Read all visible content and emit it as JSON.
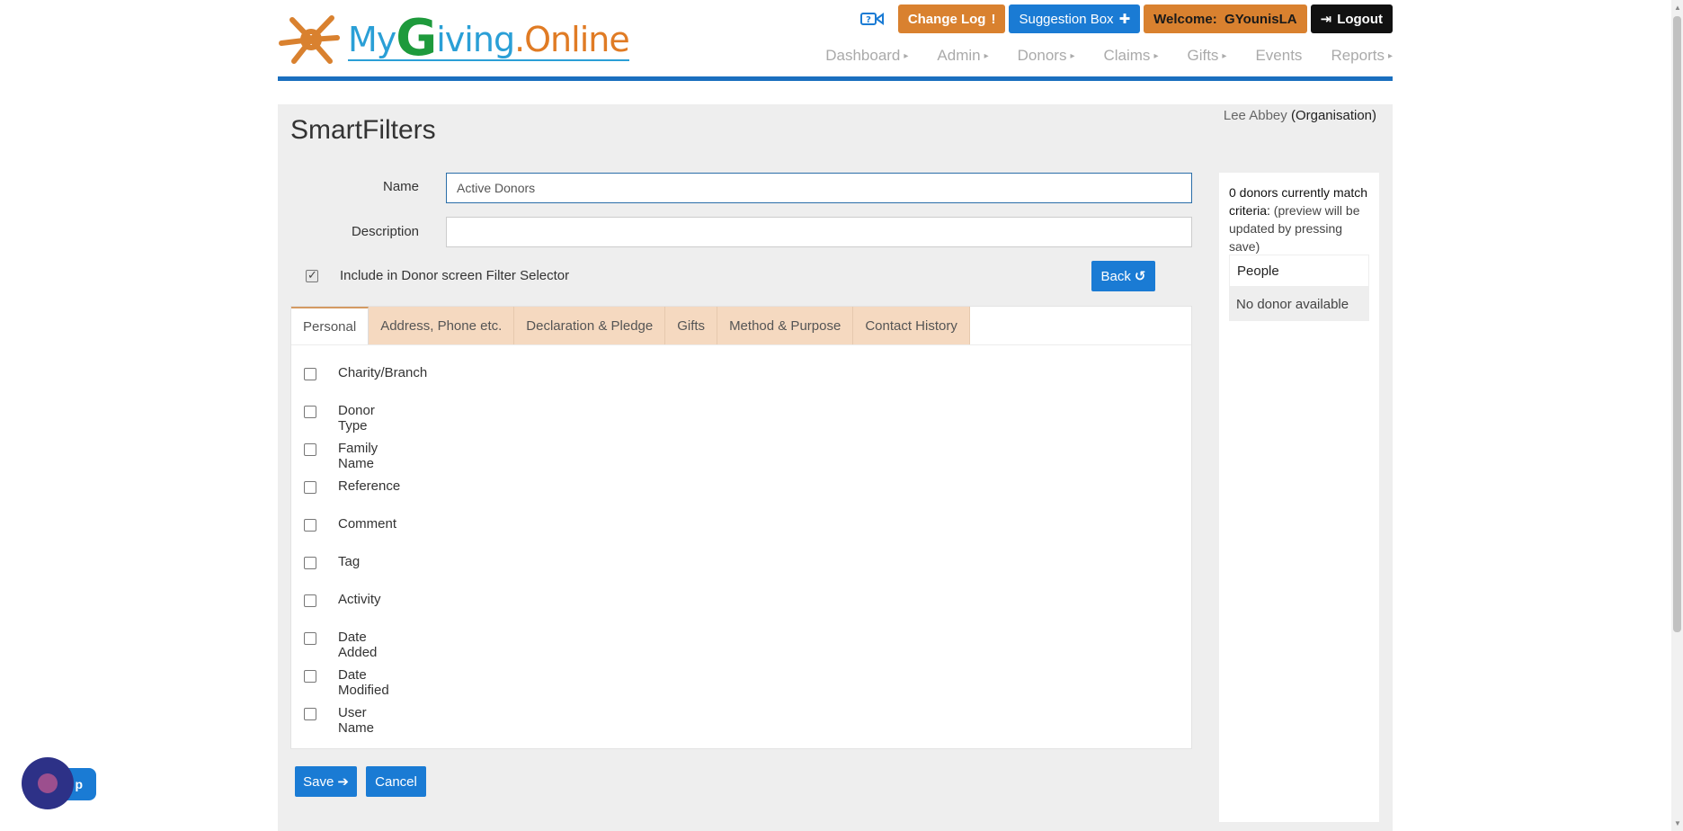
{
  "header": {
    "logo": {
      "my": "My",
      "g": "G",
      "iving": "iving",
      "dot_online": ".Online"
    },
    "change_log_label": "Change Log",
    "suggestion_box_label": "Suggestion Box",
    "welcome_label": "Welcome:  GYounisLA",
    "logout_label": "Logout",
    "nav": [
      {
        "label": "Dashboard",
        "caret": true
      },
      {
        "label": "Admin",
        "caret": true
      },
      {
        "label": "Donors",
        "caret": true
      },
      {
        "label": "Claims",
        "caret": true
      },
      {
        "label": "Gifts",
        "caret": true
      },
      {
        "label": "Events",
        "caret": false
      },
      {
        "label": "Reports",
        "caret": true
      }
    ]
  },
  "org": {
    "name": "Lee Abbey",
    "type": "(Organisation)"
  },
  "page_title": "SmartFilters",
  "form": {
    "name_label": "Name",
    "name_value": "Active Donors",
    "description_label": "Description",
    "description_value": "",
    "include_label": "Include in Donor screen Filter Selector",
    "include_checked": true,
    "back_label": "Back"
  },
  "tabs": [
    {
      "label": "Personal",
      "active": true
    },
    {
      "label": "Address, Phone etc.",
      "active": false
    },
    {
      "label": "Declaration & Pledge",
      "active": false
    },
    {
      "label": "Gifts",
      "active": false
    },
    {
      "label": "Method & Purpose",
      "active": false
    },
    {
      "label": "Contact History",
      "active": false
    }
  ],
  "criteria": [
    "Charity/Branch",
    "Donor Type",
    "Family Name",
    "Reference",
    "Comment",
    "Tag",
    "Activity",
    "Date Added",
    "Date Modified",
    "User Name"
  ],
  "actions": {
    "save_label": "Save",
    "cancel_label": "Cancel"
  },
  "preview": {
    "count_text": "0 donors currently match criteria:",
    "note_text": "(preview will be updated by pressing save)",
    "people_header": "People",
    "empty_text": "No donor available"
  },
  "help": {
    "label": "p"
  },
  "colors": {
    "accent_blue": "#1a7bd4",
    "accent_orange": "#d9812f",
    "tab_bg": "#f5d9c0"
  }
}
